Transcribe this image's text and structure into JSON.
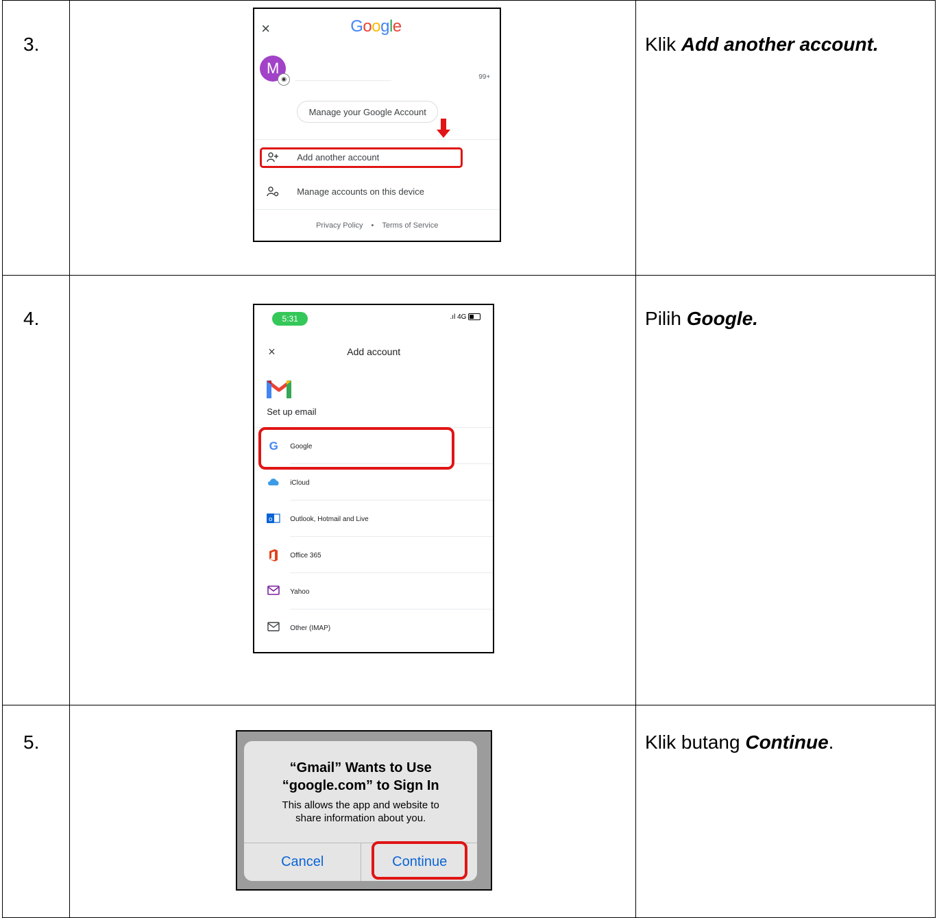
{
  "rows": [
    {
      "number": "3.",
      "desc_prefix": "Klik ",
      "desc_bold": "Add another account.",
      "desc_suffix": ""
    },
    {
      "number": "4.",
      "desc_prefix": "Pilih ",
      "desc_bold": "Google.",
      "desc_suffix": ""
    },
    {
      "number": "5.",
      "desc_prefix": "Klik butang ",
      "desc_bold": "Continue",
      "desc_suffix": "."
    }
  ],
  "shot1": {
    "close_glyph": "×",
    "logo_letters": [
      {
        "ch": "G",
        "color": "#4285f4"
      },
      {
        "ch": "o",
        "color": "#ea4335"
      },
      {
        "ch": "o",
        "color": "#fbbc05"
      },
      {
        "ch": "g",
        "color": "#4285f4"
      },
      {
        "ch": "l",
        "color": "#34a853"
      },
      {
        "ch": "e",
        "color": "#ea4335"
      }
    ],
    "avatar_letter": "M",
    "badge": "99+",
    "manage_button": "Manage your Google Account",
    "menu": [
      {
        "icon": "add-person-icon",
        "glyph": "👤+",
        "label": "Add another account"
      },
      {
        "icon": "manage-accounts-icon",
        "glyph": "👤⚙",
        "label": "Manage accounts on this device"
      }
    ],
    "footer_privacy": "Privacy Policy",
    "footer_dot": "•",
    "footer_terms": "Terms of Service",
    "highlight_color": "#e01515"
  },
  "shot2": {
    "time": "5:31",
    "network": ".ıl 4G",
    "close_glyph": "×",
    "title": "Add account",
    "setup_label": "Set up email",
    "providers": [
      {
        "icon": "google-icon",
        "label": "Google"
      },
      {
        "icon": "icloud-icon",
        "label": "iCloud"
      },
      {
        "icon": "outlook-icon",
        "label": "Outlook, Hotmail and Live"
      },
      {
        "icon": "office365-icon",
        "label": "Office 365"
      },
      {
        "icon": "yahoo-mail-icon",
        "label": "Yahoo"
      },
      {
        "icon": "imap-mail-icon",
        "label": "Other (IMAP)"
      }
    ]
  },
  "shot3": {
    "title_line1": "“Gmail” Wants to Use",
    "title_line2": "“google.com” to Sign In",
    "body_line1": "This allows the app and website to",
    "body_line2": "share information about you.",
    "cancel_label": "Cancel",
    "continue_label": "Continue"
  }
}
